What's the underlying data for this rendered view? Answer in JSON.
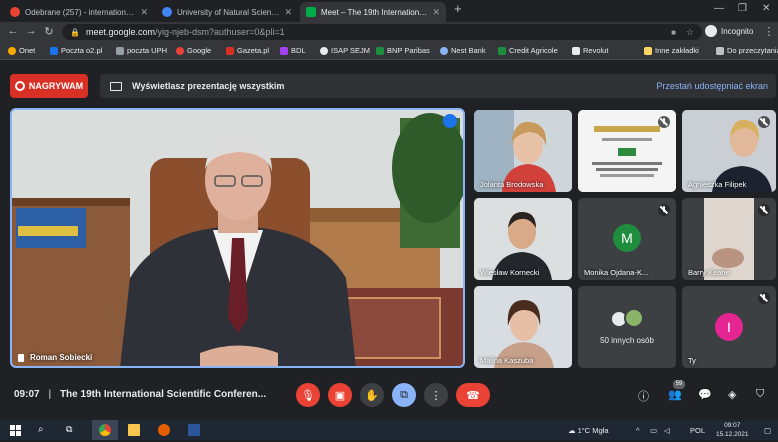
{
  "browser": {
    "tabs": [
      {
        "title": "Odebrane (257) - international.o...",
        "active": false,
        "favicon_color": "#ea4335"
      },
      {
        "title": "University of Natural Sciences a...",
        "active": false,
        "favicon_color": "#4285f4"
      },
      {
        "title": "Meet – The 19th International Sci...",
        "active": true,
        "favicon_color": "#00ac47"
      }
    ],
    "new_tab": "+",
    "address": {
      "host": "meet.google.com",
      "path": "/yig-njeb-dsm?authuser=0&pli=1"
    },
    "profile": "Incognito",
    "bookmarks": [
      {
        "label": "Onet",
        "color": "#f9ab00"
      },
      {
        "label": "Poczta o2.pl",
        "color": "#1a73e8"
      },
      {
        "label": "poczta UPH",
        "color": "#9aa0a6"
      },
      {
        "label": "Google",
        "color": "#ea4335"
      },
      {
        "label": "Gazeta.pl",
        "color": "#d93025"
      },
      {
        "label": "BDL",
        "color": "#a142f4"
      },
      {
        "label": "ISAP SEJM",
        "color": "#e8eaed"
      },
      {
        "label": "BNP Paribas",
        "color": "#1e8e3e"
      },
      {
        "label": "Nest Bank",
        "color": "#8ab4f8"
      },
      {
        "label": "Credit Agricole",
        "color": "#1e8e3e"
      },
      {
        "label": "Revolut",
        "color": "#e8eaed"
      },
      {
        "label": "Inne zakładki",
        "color": "#fdd663"
      },
      {
        "label": "Do przeczytania",
        "color": "#bdc1c6"
      }
    ]
  },
  "meet": {
    "recording_label": "NAGRYWAM",
    "presenting_text": "Wyświetlasz prezentację wszystkim",
    "stop_sharing": "Przestań udostępniać ekran",
    "main_speaker": "Roman Sobiecki",
    "participants": [
      {
        "name": "Jolanta Brodowska",
        "kind": "video"
      },
      {
        "name": "",
        "kind": "screen"
      },
      {
        "name": "Agnieszka Filipek",
        "kind": "video"
      },
      {
        "name": "Wiesław Kornecki",
        "kind": "video"
      },
      {
        "name": "Monika Ojdana-K...",
        "kind": "avatar",
        "initial": "M",
        "color": "#1e8e3e"
      },
      {
        "name": "Barry Keane",
        "kind": "video"
      },
      {
        "name": "Malina Kaszuba",
        "kind": "video"
      },
      {
        "name": "50 innych osób",
        "kind": "group"
      },
      {
        "name": "Ty",
        "kind": "avatar",
        "initial": "I",
        "color": "#e52592"
      }
    ],
    "time": "09:07",
    "meeting_title": "The 19th International Scientific Conferen...",
    "people_count": "59"
  },
  "taskbar": {
    "weather": "1°C  Mgła",
    "lang": "POL",
    "time": "09:07",
    "date": "15.12.2021"
  }
}
